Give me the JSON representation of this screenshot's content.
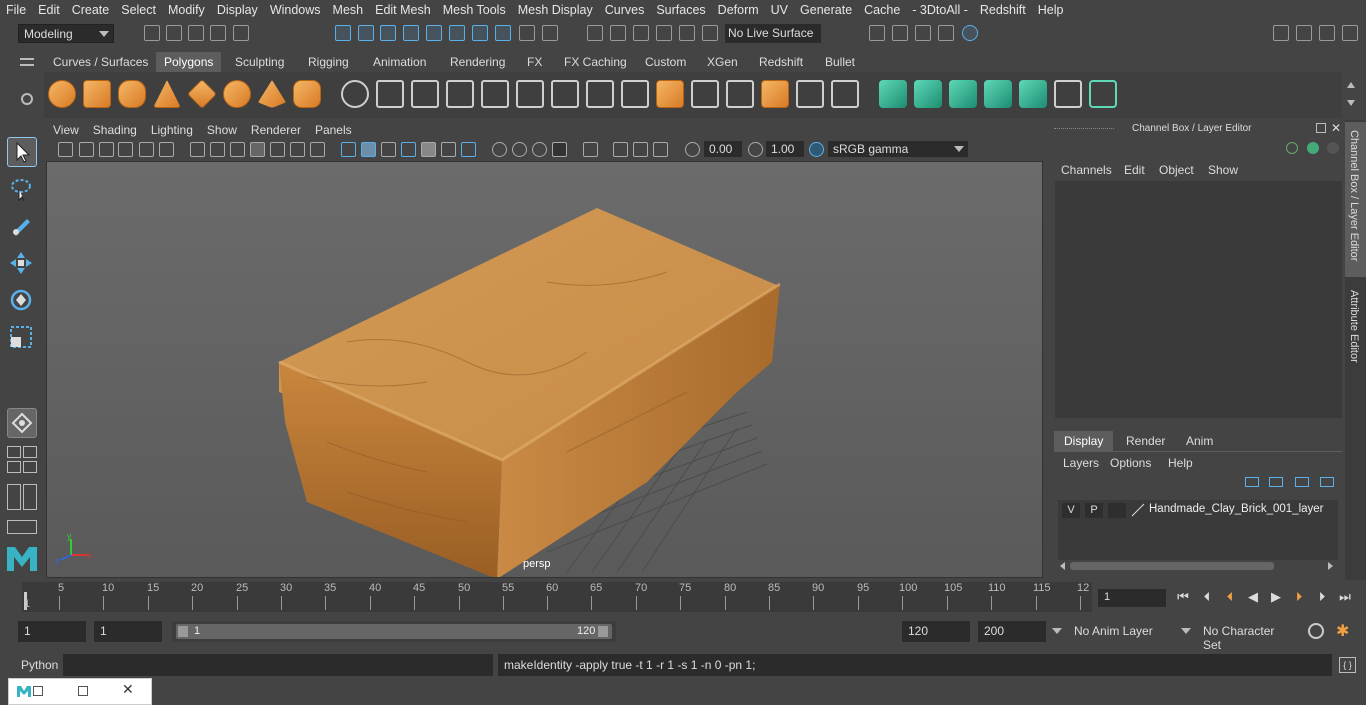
{
  "menubar": [
    "File",
    "Edit",
    "Create",
    "Select",
    "Modify",
    "Display",
    "Windows",
    "Mesh",
    "Edit Mesh",
    "Mesh Tools",
    "Mesh Display",
    "Curves",
    "Surfaces",
    "Deform",
    "UV",
    "Generate",
    "Cache",
    "- 3DtoAll -",
    "Redshift",
    "Help"
  ],
  "status": {
    "mode": "Modeling",
    "live_surface": "No Live Surface"
  },
  "shelf_tabs": [
    "Curves / Surfaces",
    "Polygons",
    "Sculpting",
    "Rigging",
    "Animation",
    "Rendering",
    "FX",
    "FX Caching",
    "Custom",
    "XGen",
    "Redshift",
    "Bullet"
  ],
  "shelf_active": "Polygons",
  "viewport": {
    "menu": [
      "View",
      "Shading",
      "Lighting",
      "Show",
      "Renderer",
      "Panels"
    ],
    "exposure": "0.00",
    "gamma": "1.00",
    "colorspace": "sRGB gamma",
    "camera": "persp",
    "axis_x": "x",
    "axis_y": "y",
    "axis_z": "z"
  },
  "channelbox": {
    "title": "Channel Box / Layer Editor",
    "menu": [
      "Channels",
      "Edit",
      "Object",
      "Show"
    ],
    "layer_tabs": [
      "Display",
      "Render",
      "Anim"
    ],
    "layer_menu": [
      "Layers",
      "Options",
      "Help"
    ],
    "layer": {
      "v": "V",
      "p": "P",
      "name": "Handmade_Clay_Brick_001_layer"
    }
  },
  "side_tabs": [
    "Channel Box / Layer Editor",
    "Attribute Editor"
  ],
  "timeline": {
    "ticks": [
      "5",
      "10",
      "15",
      "20",
      "25",
      "30",
      "35",
      "40",
      "45",
      "50",
      "55",
      "60",
      "65",
      "70",
      "75",
      "80",
      "85",
      "90",
      "95",
      "100",
      "105",
      "110",
      "115",
      "12"
    ],
    "start_marker": "1",
    "current_frame": "1"
  },
  "range": {
    "start": "1",
    "anim_start": "1",
    "slider_start": "1",
    "slider_end": "120",
    "end": "120",
    "anim_end": "200",
    "anim_layer": "No Anim Layer",
    "char_set": "No Character Set"
  },
  "command": {
    "lang": "Python",
    "output": "makeIdentity -apply true -t 1 -r 1 -s 1 -n 0 -pn 1;"
  }
}
